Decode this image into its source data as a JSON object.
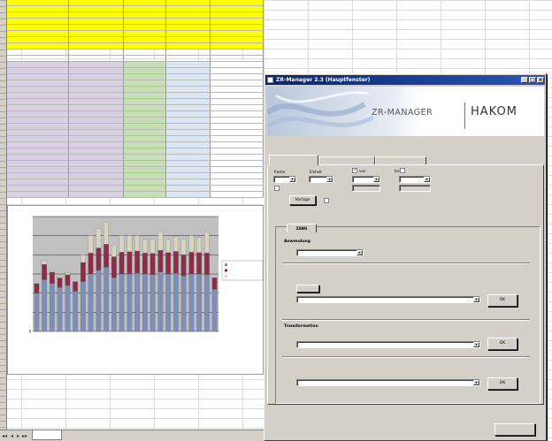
{
  "window": {
    "title": "ZR-Manager 2.3 (Hauptfenster)",
    "brand": "ZR-MANAGER",
    "company": "HAKOM",
    "brand_sub": ""
  },
  "tabs": [
    "",
    "",
    ""
  ],
  "filter": {
    "raster_label": "Raster",
    "raster_value": "",
    "einheit_label": "Einheit",
    "einheit_value": "",
    "von_label": "von",
    "von_value": "",
    "bis_label": "bis",
    "bis_value": "",
    "ab_label": "",
    "kurs_label": "",
    "vorlage_button": "Vorlage",
    "check2_label": ""
  },
  "zr_tab": "ZANG",
  "sections": {
    "anwendung_label": "Anwendung",
    "anwendung_value": "",
    "zeitreihe_label": "",
    "neu_button": "",
    "zeitreihe_value": "",
    "transformation_label": "Transformation",
    "transformation_sub": "",
    "zeit_label": "",
    "zeit_sub": "",
    "ok_button": "OK"
  },
  "close_button": "",
  "sheet": {
    "tab_name": "",
    "nav_icons": [
      "◂◂",
      "◂",
      "▸",
      "▸▸"
    ],
    "header_row1": [
      "",
      "",
      "",
      "",
      ""
    ],
    "header_row2": [
      "",
      "",
      "",
      "",
      ""
    ],
    "total_row": [
      "",
      "",
      "",
      "",
      ""
    ],
    "unit_row": [
      "",
      "",
      "",
      "",
      ""
    ],
    "rows": [
      [
        "",
        "",
        "",
        "",
        ""
      ],
      [
        "",
        "",
        "",
        "",
        ""
      ],
      [
        "",
        "",
        "",
        "",
        ""
      ],
      [
        "",
        "",
        "",
        "",
        ""
      ],
      [
        "",
        "",
        "",
        "",
        ""
      ],
      [
        "",
        "",
        "",
        "",
        ""
      ],
      [
        "",
        "",
        "",
        "",
        ""
      ],
      [
        "",
        "",
        "",
        "",
        ""
      ],
      [
        "",
        "",
        "",
        "",
        ""
      ],
      [
        "",
        "",
        "",
        "",
        ""
      ],
      [
        "",
        "",
        "",
        "",
        ""
      ],
      [
        "",
        "",
        "",
        "",
        ""
      ],
      [
        "",
        "",
        "",
        "",
        ""
      ],
      [
        "",
        "",
        "",
        "",
        ""
      ],
      [
        "",
        "",
        "",
        "",
        ""
      ],
      [
        "",
        "",
        "",
        "",
        ""
      ],
      [
        "",
        "",
        "",
        "",
        ""
      ],
      [
        "",
        "",
        "",
        "",
        ""
      ],
      [
        "",
        "",
        "",
        "",
        ""
      ],
      [
        "",
        "",
        "",
        "",
        ""
      ],
      [
        "",
        "",
        "",
        "",
        ""
      ],
      [
        "",
        "",
        "",
        "",
        ""
      ]
    ]
  },
  "chart_data": {
    "type": "bar",
    "stacked": true,
    "categories": [
      "",
      "",
      "",
      "",
      "",
      "",
      "",
      "",
      "",
      "",
      "",
      "",
      "",
      "",
      "",
      "",
      "",
      "",
      "",
      "",
      "",
      "",
      "",
      ""
    ],
    "series": [
      {
        "values": [
          100000,
          135000,
          125000,
          115000,
          120000,
          105000,
          130000,
          150000,
          160000,
          168000,
          140000,
          150000,
          150000,
          152000,
          150000,
          148000,
          155000,
          150000,
          152000,
          145000,
          150000,
          150000,
          148000,
          110000
        ],
        "color": "#7d8fb8"
      },
      {
        "values": [
          25000,
          40000,
          30000,
          25000,
          28000,
          25000,
          50000,
          55000,
          58000,
          60000,
          55000,
          57000,
          58000,
          58000,
          55000,
          56000,
          57000,
          56000,
          57000,
          55000,
          57000,
          56000,
          57000,
          30000
        ],
        "color": "#8b2d4a"
      },
      {
        "values": [
          0,
          10000,
          5000,
          5000,
          5000,
          0,
          20000,
          45000,
          50000,
          57000,
          30000,
          43000,
          42000,
          40000,
          35000,
          36000,
          48000,
          34000,
          38000,
          40000,
          43000,
          39000,
          55000,
          0
        ],
        "color": "#d8d4c0"
      }
    ],
    "ylim": [
      0,
      300000
    ],
    "ytick_labels": [
      "0",
      "",
      "",
      "",
      "",
      "",
      ""
    ],
    "grid": true,
    "legend": "right",
    "legend_labels": [
      "",
      "",
      ""
    ]
  }
}
